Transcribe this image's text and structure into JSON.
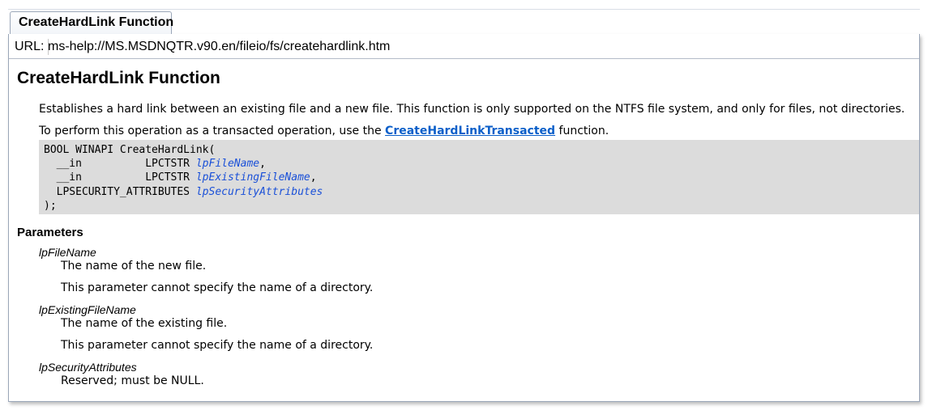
{
  "tab": {
    "title": "CreateHardLink Function"
  },
  "urlbar": {
    "label": "URL:",
    "value": "ms-help://MS.MSDNQTR.v90.en/fileio/fs/createhardlink.htm"
  },
  "page": {
    "title": "CreateHardLink Function",
    "intro": "Establishes a hard link between an existing file and a new file. This function is only supported on the NTFS file system, and only for files, not directories.",
    "transacted_prefix": "To perform this operation as a transacted operation, use the ",
    "transacted_link": "CreateHardLinkTransacted",
    "transacted_suffix": " function.",
    "syntax": {
      "line1": "BOOL WINAPI CreateHardLink(",
      "l2_prefix": "  __in          LPCTSTR ",
      "l2_arg": "lpFileName",
      "l2_suffix": ",",
      "l3_prefix": "  __in          LPCTSTR ",
      "l3_arg": "lpExistingFileName",
      "l3_suffix": ",",
      "l4_prefix": "  LPSECURITY_ATTRIBUTES ",
      "l4_arg": "lpSecurityAttributes",
      "line5": ");"
    },
    "parameters_heading": "Parameters",
    "parameters": [
      {
        "name": "lpFileName",
        "desc1": "The name of the new file.",
        "desc2": "This parameter cannot specify the name of a directory."
      },
      {
        "name": "lpExistingFileName",
        "desc1": "The name of the existing file.",
        "desc2": "This parameter cannot specify the name of a directory."
      },
      {
        "name": "lpSecurityAttributes",
        "desc1": "Reserved; must be NULL."
      }
    ]
  }
}
